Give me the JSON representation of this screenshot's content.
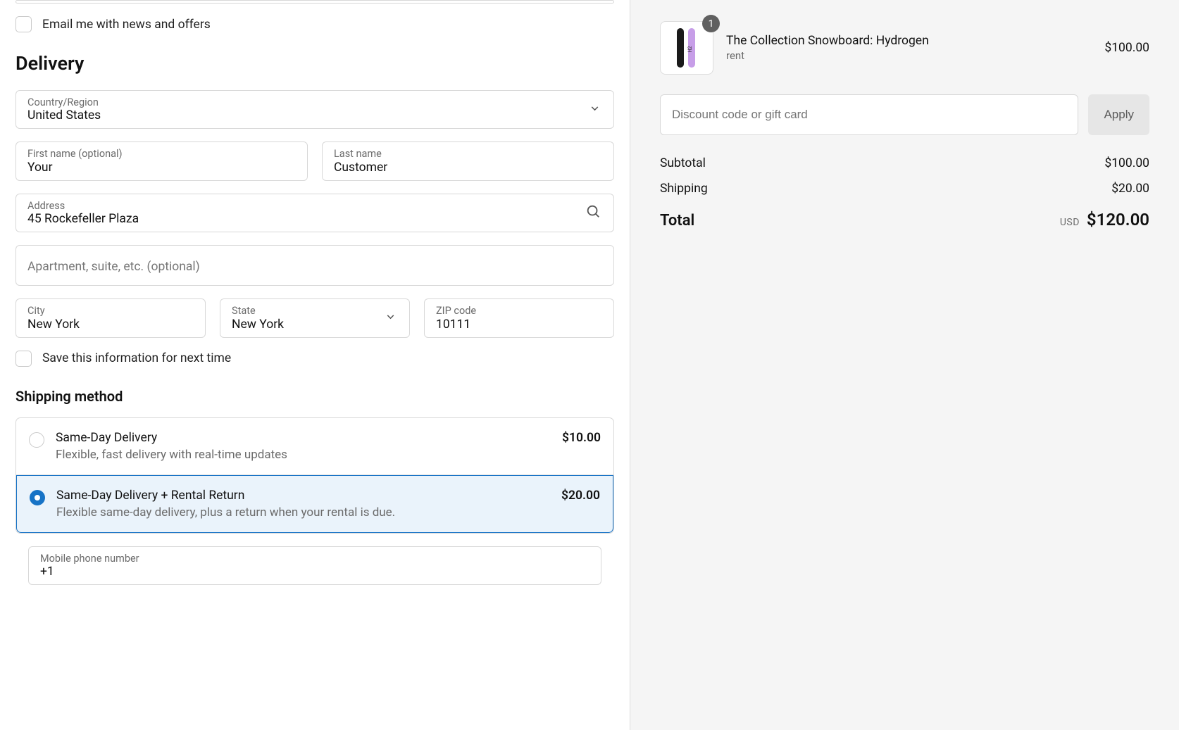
{
  "checkboxes": {
    "email_news": "Email me with news and offers",
    "save_info": "Save this information for next time"
  },
  "delivery": {
    "title": "Delivery",
    "country_label": "Country/Region",
    "country_value": "United States",
    "first_name_label": "First name (optional)",
    "first_name_value": "Your",
    "last_name_label": "Last name",
    "last_name_value": "Customer",
    "address_label": "Address",
    "address_value": "45 Rockefeller Plaza",
    "apartment_placeholder": "Apartment, suite, etc. (optional)",
    "city_label": "City",
    "city_value": "New York",
    "state_label": "State",
    "state_value": "New York",
    "zip_label": "ZIP code",
    "zip_value": "10111"
  },
  "shipping": {
    "title": "Shipping method",
    "options": [
      {
        "name": "Same-Day Delivery",
        "desc": "Flexible, fast delivery with real-time updates",
        "price": "$10.00",
        "selected": false
      },
      {
        "name": "Same-Day Delivery + Rental Return",
        "desc": "Flexible same-day delivery, plus a return when your rental is due.",
        "price": "$20.00",
        "selected": true
      }
    ],
    "phone_label": "Mobile phone number",
    "phone_value": "+1"
  },
  "summary": {
    "item": {
      "qty": "1",
      "title": "The Collection Snowboard: Hydrogen",
      "variant": "rent",
      "price": "$100.00"
    },
    "discount_placeholder": "Discount code or gift card",
    "apply_label": "Apply",
    "subtotal_label": "Subtotal",
    "subtotal_value": "$100.00",
    "shipping_label": "Shipping",
    "shipping_value": "$20.00",
    "total_label": "Total",
    "currency": "USD",
    "total_value": "$120.00"
  }
}
